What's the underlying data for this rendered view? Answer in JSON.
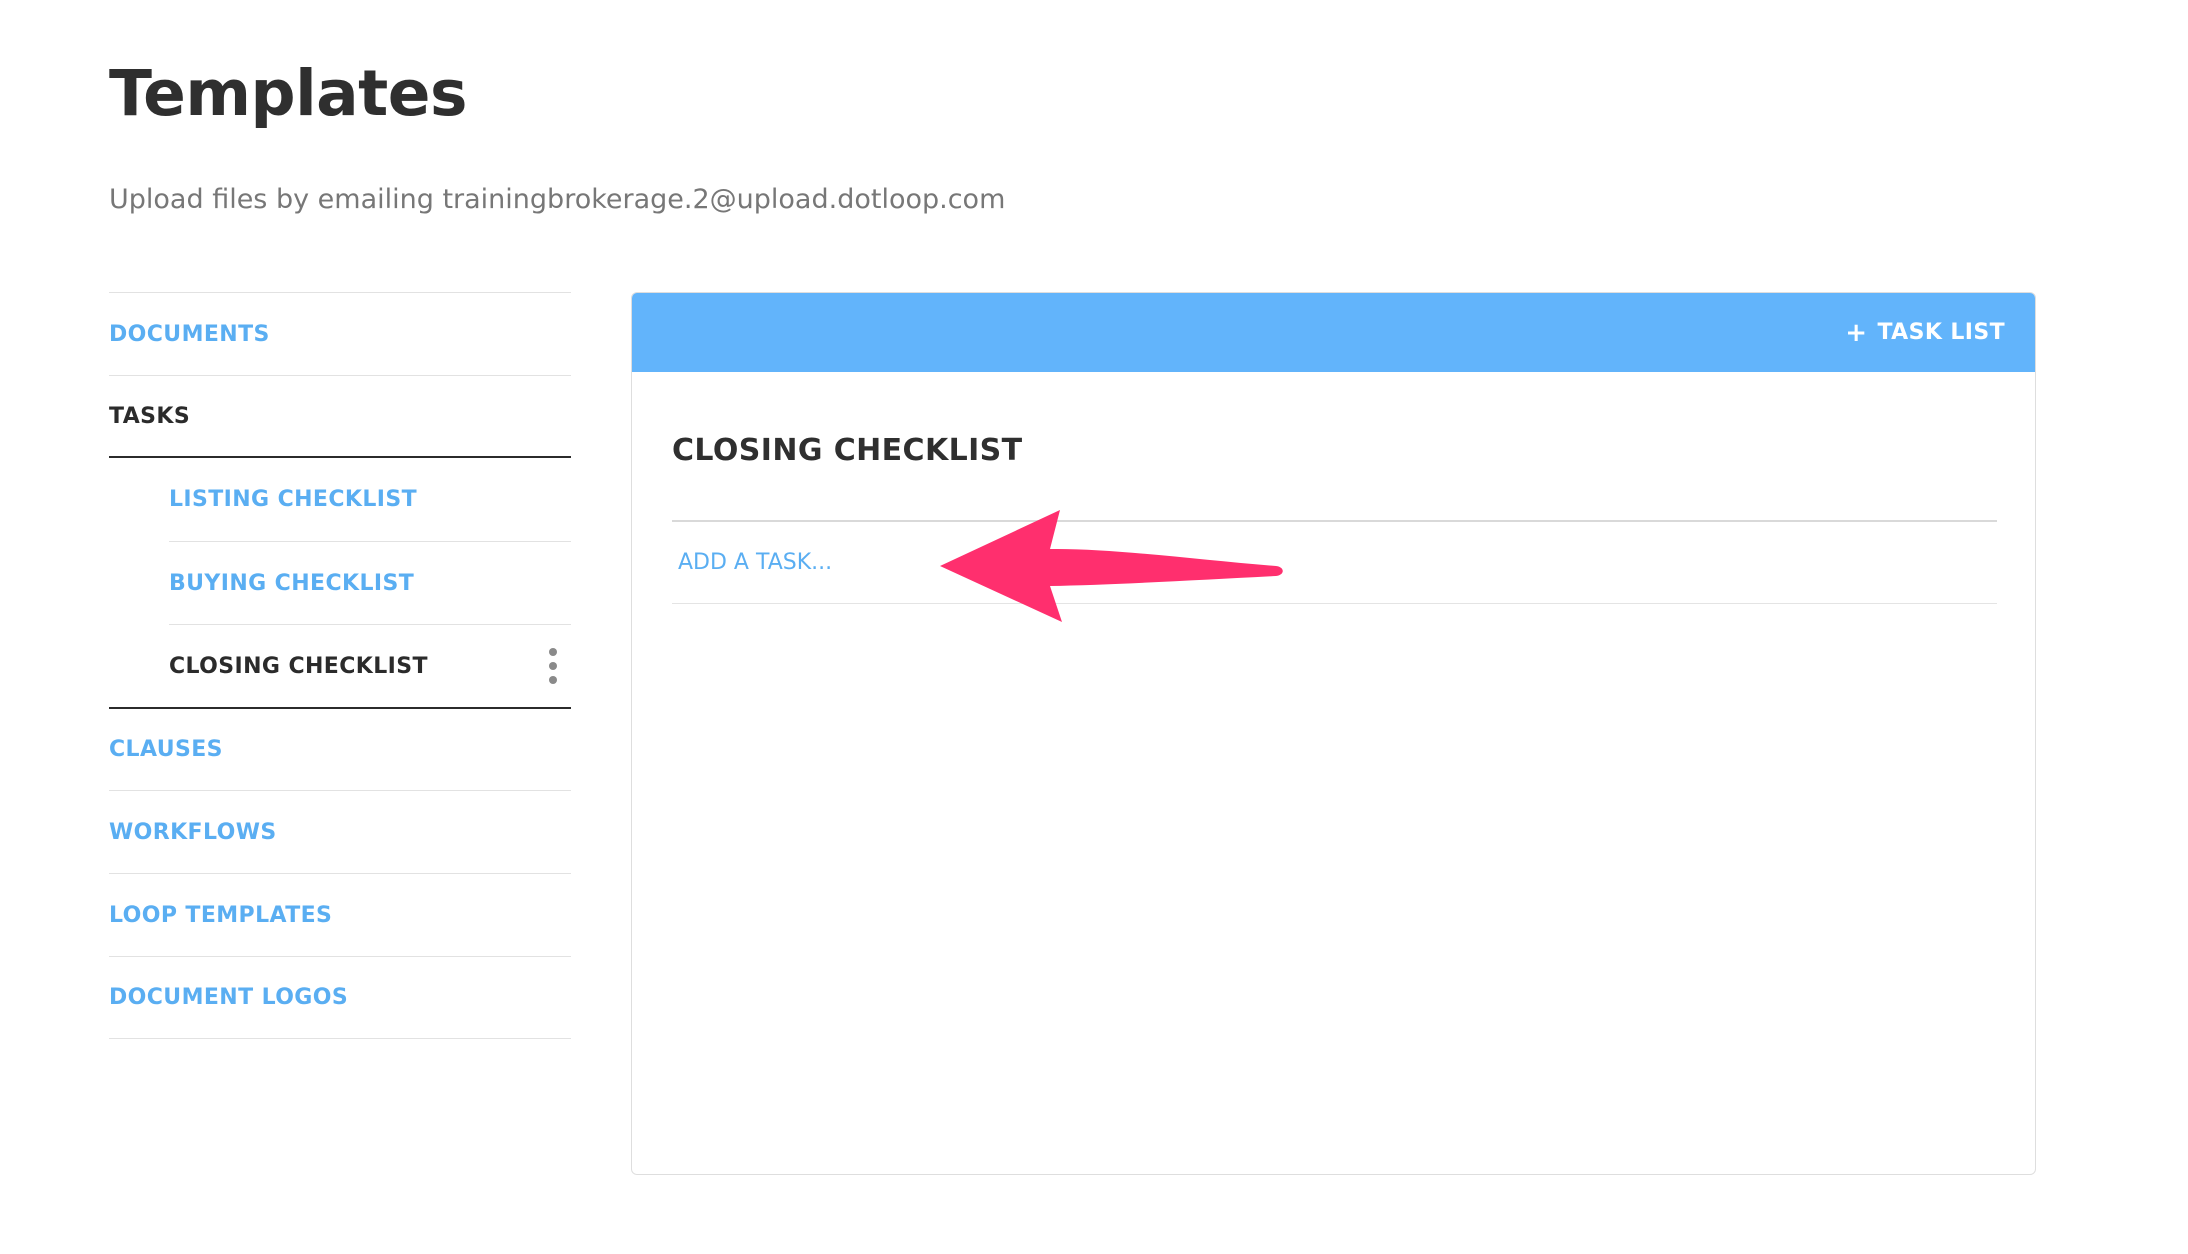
{
  "page": {
    "title": "Templates",
    "subtitle": "Upload files by emailing trainingbrokerage.2@upload.dotloop.com"
  },
  "sidebar": {
    "items": [
      {
        "label": "DOCUMENTS"
      },
      {
        "label": "TASKS"
      },
      {
        "label": "CLAUSES"
      },
      {
        "label": "WORKFLOWS"
      },
      {
        "label": "LOOP TEMPLATES"
      },
      {
        "label": "DOCUMENT LOGOS"
      }
    ],
    "task_lists": [
      {
        "label": "LISTING CHECKLIST"
      },
      {
        "label": "BUYING CHECKLIST"
      },
      {
        "label": "CLOSING CHECKLIST",
        "active": true
      }
    ]
  },
  "panel": {
    "add_button_label": "TASK LIST",
    "add_button_icon": "plus-icon",
    "checklist_title": "CLOSING CHECKLIST",
    "add_task_placeholder": "ADD A TASK..."
  },
  "colors": {
    "accent_blue": "#5aaef2",
    "header_blue": "#62b4fb",
    "annotation_pink": "#ff2f6e"
  }
}
